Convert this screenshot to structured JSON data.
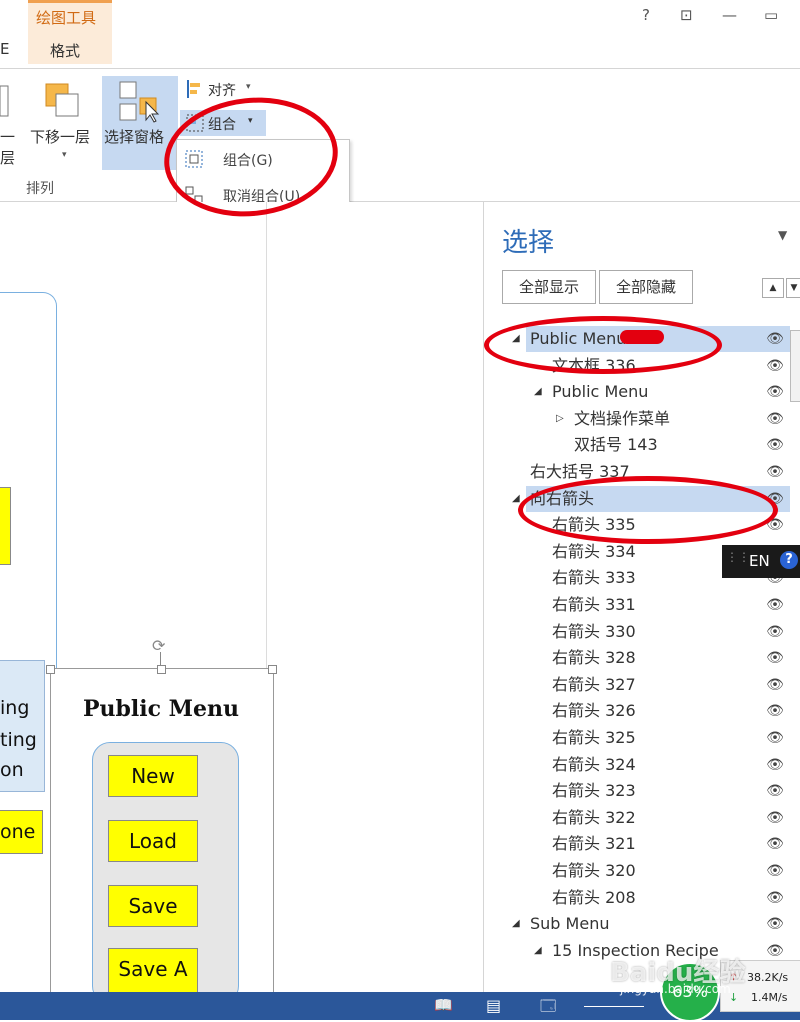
{
  "context_tab": {
    "group": "绘图工具",
    "tab": "格式",
    "left_cut": "E"
  },
  "window": {
    "help": "?",
    "ribbon_opts": "⊡",
    "minimize": "—",
    "restore": "▭"
  },
  "ribbon": {
    "prev_layer_cut": "一层",
    "send_backward": "下移一层",
    "selection_pane": "选择窗格",
    "align": "对齐",
    "group": "组合",
    "group_label": "排列",
    "dropdown": [
      {
        "label": "组合(G)"
      },
      {
        "label": "取消组合(U)"
      }
    ]
  },
  "canvas": {
    "left_texts": [
      "ing",
      "ting",
      "on"
    ],
    "left_button_cut": "one",
    "selected_title": "Public Menu",
    "buttons": [
      "New",
      "Load",
      "Save",
      "Save A"
    ]
  },
  "pane": {
    "title": "选择",
    "show_all": "全部显示",
    "hide_all": "全部隐藏",
    "items": [
      {
        "label": "Public Menu",
        "level": 0,
        "expanded": true,
        "selected": true
      },
      {
        "label": "文本框 336",
        "level": 1
      },
      {
        "label": "Public Menu",
        "level": 1,
        "expanded": true
      },
      {
        "label": "文档操作菜单",
        "level": 2,
        "collapsed": true
      },
      {
        "label": "双括号 143",
        "level": 2
      },
      {
        "label": "右大括号 337",
        "level": 0
      },
      {
        "label": "向右箭头",
        "level": 0,
        "expanded": true,
        "selected": true
      },
      {
        "label": "右箭头 335",
        "level": 1
      },
      {
        "label": "右箭头 334",
        "level": 1
      },
      {
        "label": "右箭头 333",
        "level": 1
      },
      {
        "label": "右箭头 331",
        "level": 1
      },
      {
        "label": "右箭头 330",
        "level": 1
      },
      {
        "label": "右箭头 328",
        "level": 1
      },
      {
        "label": "右箭头 327",
        "level": 1
      },
      {
        "label": "右箭头 326",
        "level": 1
      },
      {
        "label": "右箭头 325",
        "level": 1
      },
      {
        "label": "右箭头 324",
        "level": 1
      },
      {
        "label": "右箭头 323",
        "level": 1
      },
      {
        "label": "右箭头 322",
        "level": 1
      },
      {
        "label": "右箭头 321",
        "level": 1
      },
      {
        "label": "右箭头 320",
        "level": 1
      },
      {
        "label": "右箭头 208",
        "level": 1
      },
      {
        "label": "Sub Menu",
        "level": 0,
        "expanded": true
      },
      {
        "label": "15 Inspection Recipe",
        "level": 1,
        "expanded": true
      }
    ]
  },
  "ime": {
    "lang": "EN",
    "help": "?"
  },
  "network": {
    "up": "38.2K/s",
    "down": "1.4M/s",
    "percent": "63%"
  },
  "watermark": {
    "brand": "Baidu经验",
    "url": "jingyan.baidu.com"
  },
  "colors": {
    "accent": "#2b579a",
    "context": "#d16a13",
    "selection": "#c6d9f1",
    "annotation": "#e3000f",
    "button_fill": "#ffff00"
  }
}
